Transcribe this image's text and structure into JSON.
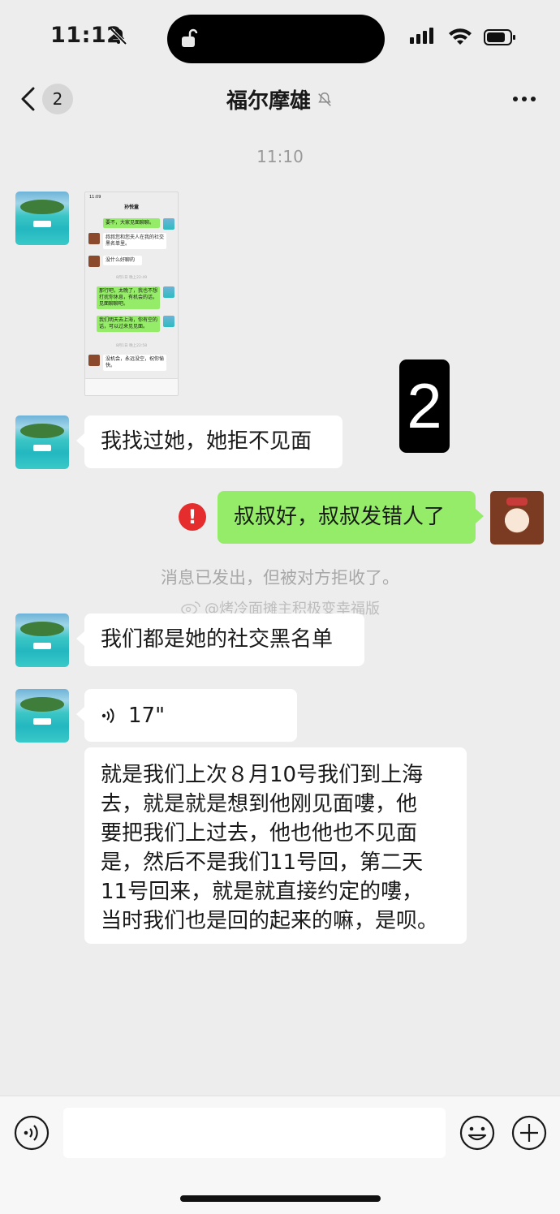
{
  "status_bar": {
    "time": "11:12",
    "icons": [
      "bell-off-icon",
      "lock-icon",
      "signal-icon",
      "wifi-icon",
      "battery-icon"
    ]
  },
  "nav": {
    "back_badge": "2",
    "title": "福尔摩雄",
    "icons": [
      "back-icon",
      "mute-bell-icon",
      "more-icon"
    ]
  },
  "timestamp": "11:10",
  "overlay_number": "2",
  "mini_screenshot": {
    "time": "11:09",
    "title": "孙悦童",
    "messages": [
      {
        "side": "right",
        "text": "要不，大家见面聊聊。"
      },
      {
        "side": "left",
        "text": "叔叔您和您夫人在我的社交黑名单里。"
      },
      {
        "side": "left",
        "text": "没什么好聊的"
      },
      {
        "side": "time",
        "text": "8月1日 晚上22:49"
      },
      {
        "side": "right",
        "text": "那行吧，太晚了，我也不想打扰你休息，有机会的话，见面聊聊吧。"
      },
      {
        "side": "right",
        "text": "我们明天去上海，你有空的话，可以过来见见面。"
      },
      {
        "side": "time",
        "text": "8月1日 晚上22:58"
      },
      {
        "side": "left",
        "text": "没机会，永远没空，祝你愉快。"
      }
    ]
  },
  "messages": [
    {
      "side": "left",
      "text": "我找过她，她拒不见面"
    },
    {
      "side": "right",
      "text": "叔叔好，叔叔发错人了",
      "status": "failed"
    },
    {
      "side": "left",
      "text": "我们都是她的社交黑名单"
    },
    {
      "side": "left",
      "type": "voice",
      "duration": "17\""
    },
    {
      "side": "left",
      "type": "transcript",
      "lines": [
        "就是我们上次８月10号我们到上海",
        "去，就是就是想到他刚见面嘍，他",
        "要把我们上过去，他也他也不见面",
        "是，然后不是我们11号回，第二天",
        "11号回来，就是就直接约定的嘍，",
        "当时我们也是回的起来的嘛，是呗。"
      ]
    }
  ],
  "system_note": "消息已发出，但被对方拒收了。",
  "watermark": "@烤冷面摊主积极变幸福版",
  "bottom_bar": {
    "icons": [
      "voice-input-icon",
      "emoji-icon",
      "plus-icon"
    ],
    "input_value": ""
  }
}
